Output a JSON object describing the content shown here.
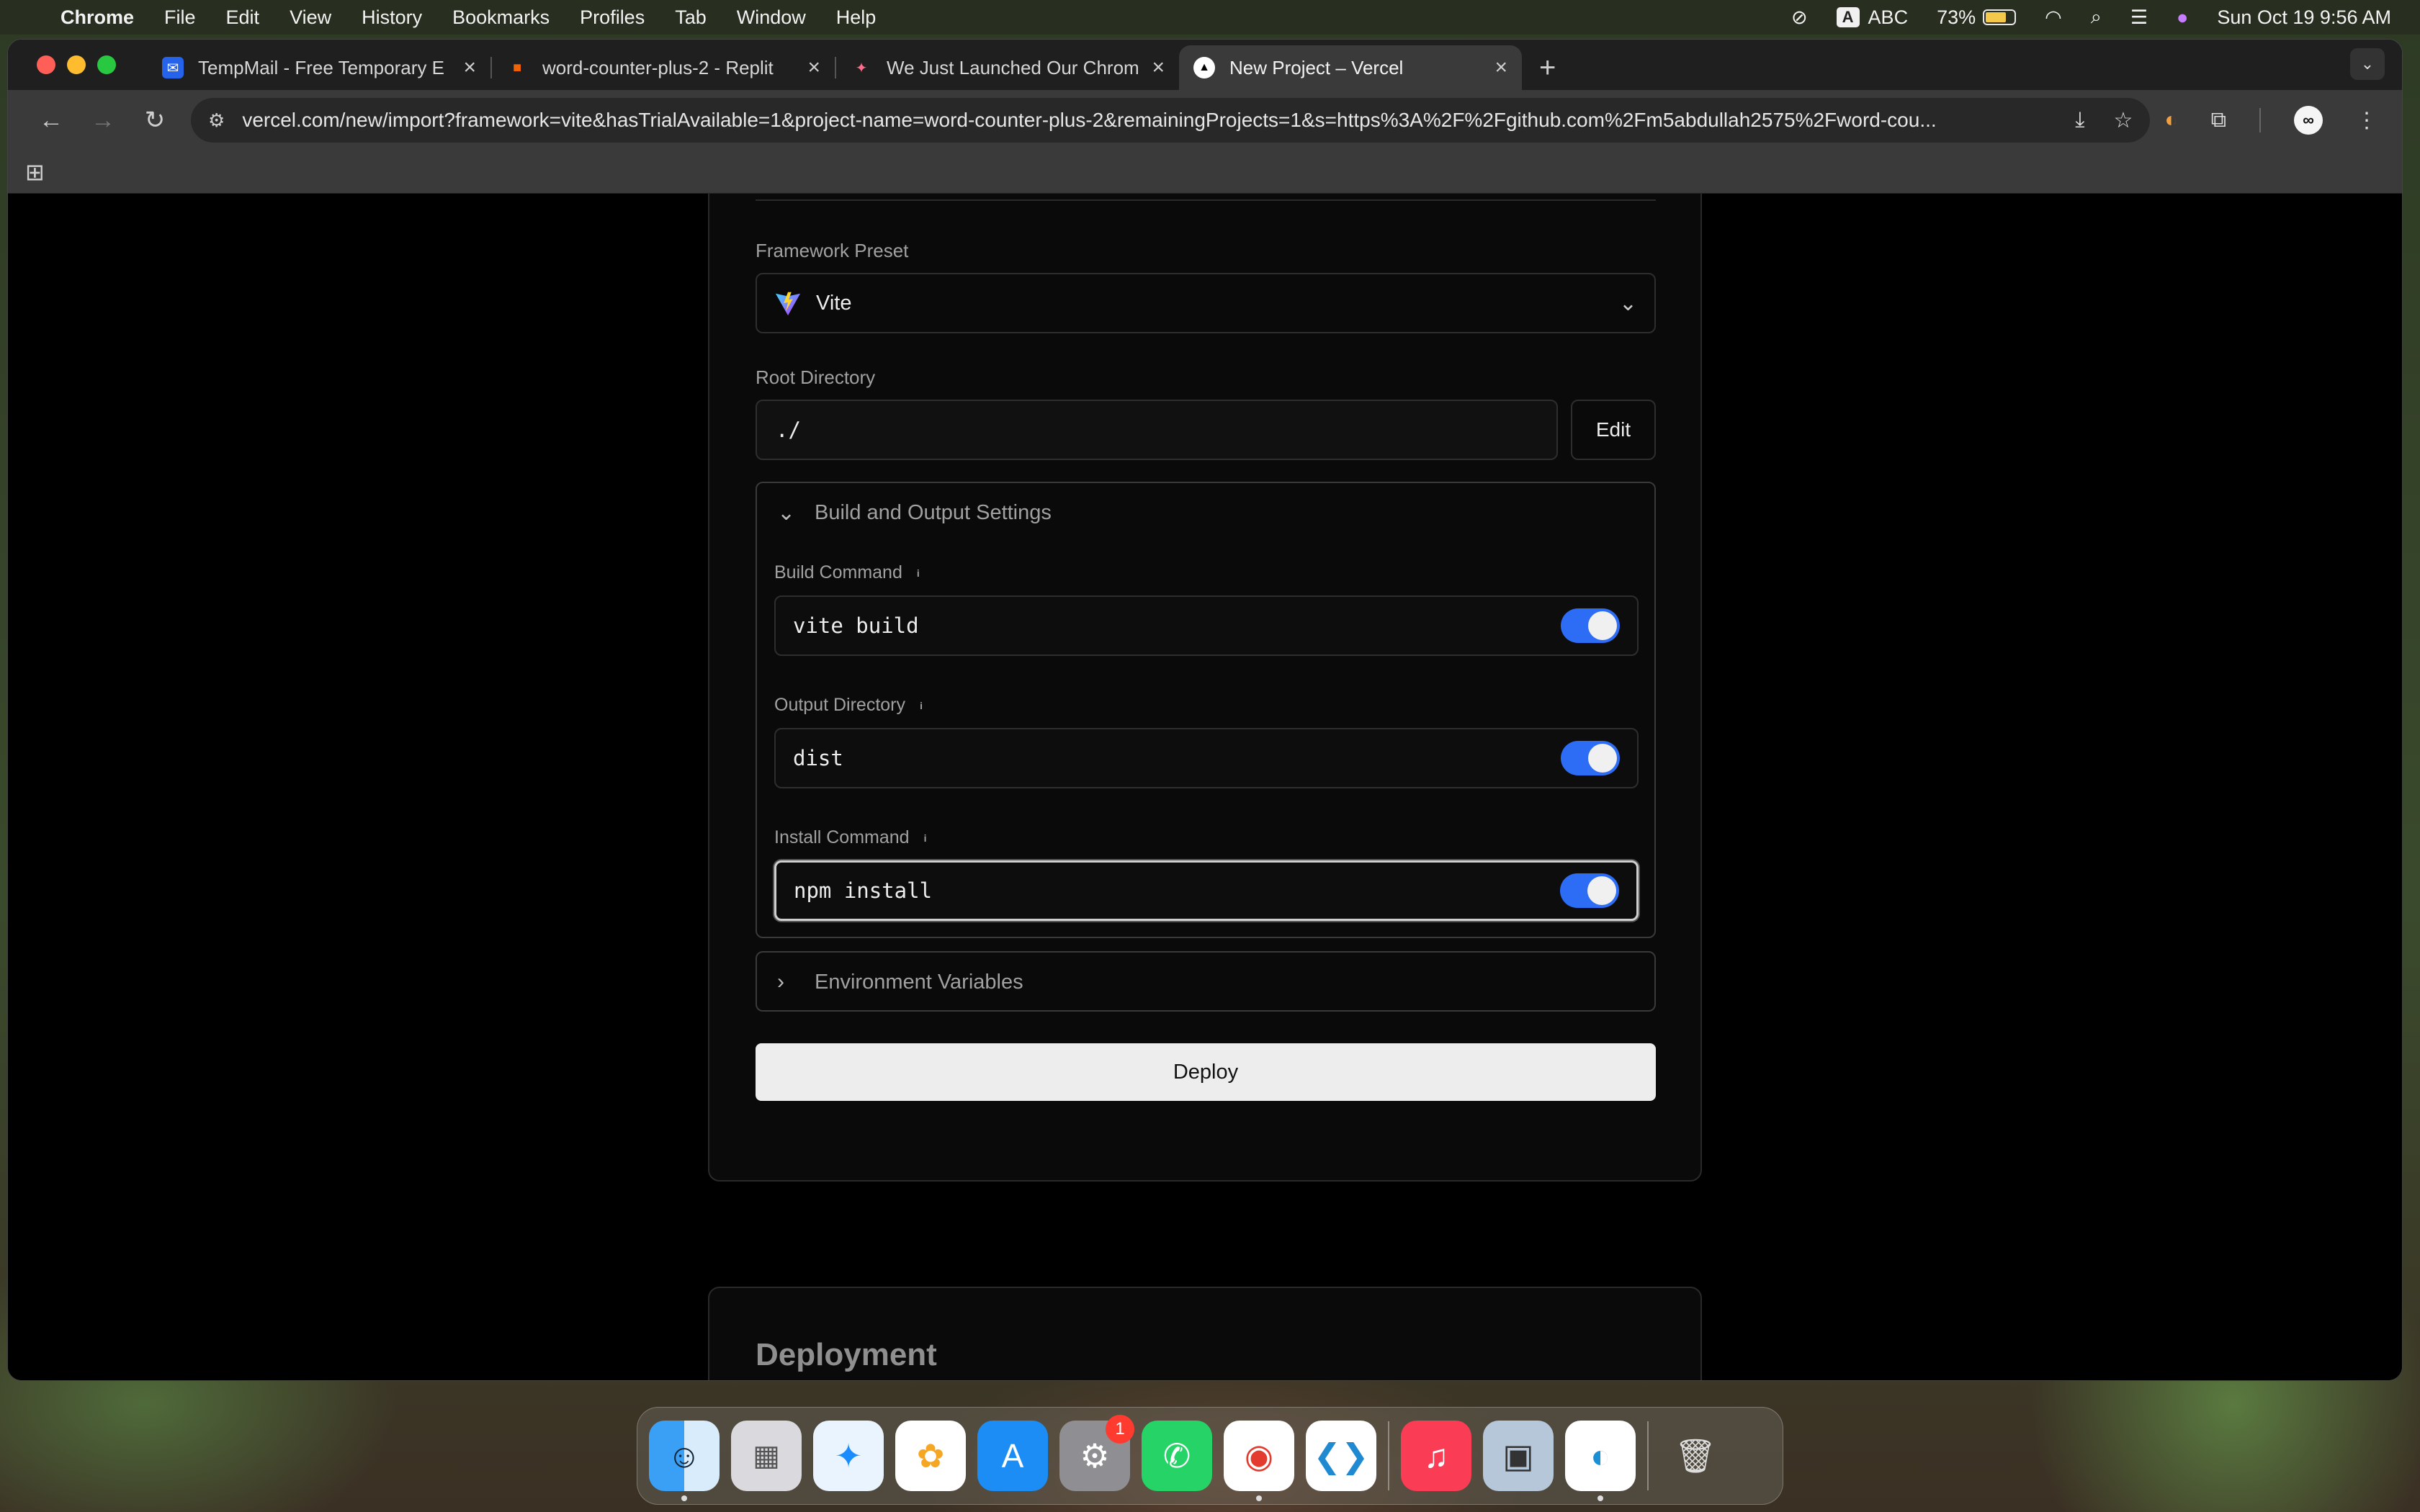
{
  "menubar": {
    "app": "Chrome",
    "items": [
      "File",
      "Edit",
      "View",
      "History",
      "Bookmarks",
      "Profiles",
      "Tab",
      "Window",
      "Help"
    ],
    "input_badge": "A",
    "input_source": "ABC",
    "battery_percent": "73%",
    "battery_level": 0.73,
    "datetime": "Sun Oct 19  9:56 AM"
  },
  "tabs": [
    {
      "title": "TempMail - Free Temporary E",
      "favicon": "tempmail-icon",
      "close": "×"
    },
    {
      "title": "word-counter-plus-2 - Replit",
      "favicon": "replit-icon",
      "close": "×"
    },
    {
      "title": "We Just Launched Our Chrom",
      "favicon": "rocket-icon",
      "close": "×"
    },
    {
      "title": "New Project – Vercel",
      "favicon": "vercel-icon",
      "close": "×",
      "active": true
    }
  ],
  "toolbar": {
    "url": "vercel.com/new/import?framework=vite&hasTrialAvailable=1&project-name=word-counter-plus-2&remainingProjects=1&s=https%3A%2F%2Fgithub.com%2Fm5abdullah2575%2Fword-cou..."
  },
  "form": {
    "framework_label": "Framework Preset",
    "framework_value": "Vite",
    "root_label": "Root Directory",
    "root_value": "./",
    "edit_label": "Edit",
    "build_section_title": "Build and Output Settings",
    "build_command_label": "Build Command",
    "build_command_value": "vite build",
    "build_command_override": true,
    "output_dir_label": "Output Directory",
    "output_dir_value": "dist",
    "output_dir_override": true,
    "install_command_label": "Install Command",
    "install_command_value": "npm install",
    "install_command_override": true,
    "env_section_title": "Environment Variables",
    "deploy_label": "Deploy"
  },
  "deployment_heading": "Deployment",
  "dock": {
    "apps": [
      "finder-icon",
      "launchpad-icon",
      "safari-icon",
      "photos-icon",
      "app-store-icon",
      "system-settings-icon",
      "whatsapp-icon",
      "chrome-icon",
      "vscode-icon",
      "music-icon",
      "preview-icon",
      "edge-icon",
      "trash-icon"
    ],
    "settings_badge": "1"
  }
}
